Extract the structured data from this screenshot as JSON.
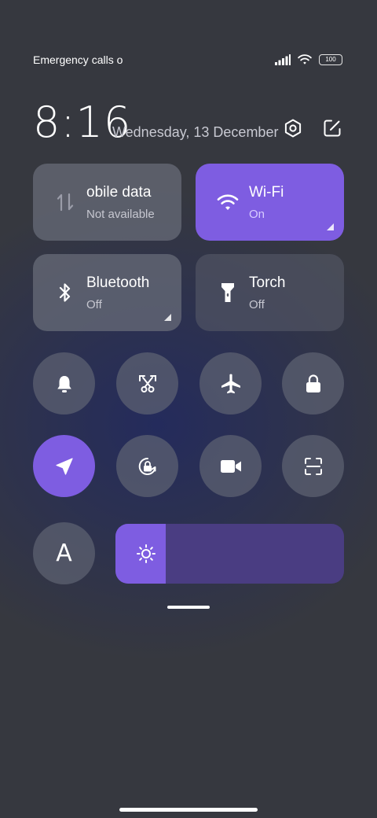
{
  "status_bar": {
    "carrier_text": "Emergency calls o",
    "battery": "100"
  },
  "header": {
    "time": "8:16",
    "date": "Wednesday, 13 December"
  },
  "tiles": {
    "mobile_data": {
      "label": "obile data",
      "status": "Not available"
    },
    "wifi": {
      "label": "Wi-Fi",
      "status": "On"
    },
    "bluetooth": {
      "label": "Bluetooth",
      "status": "Off"
    },
    "torch": {
      "label": "Torch",
      "status": "Off"
    }
  },
  "toggles": {
    "font_letter": "A"
  },
  "brightness": {
    "level_fraction": 0.22
  },
  "colors": {
    "accent": "#7e5de1",
    "tile_off": "#6a6d7a",
    "brightness_track": "#4a3d82"
  },
  "icons": [
    "signal-icon",
    "wifi-icon",
    "battery-icon",
    "settings-icon",
    "edit-icon",
    "mobile-data-icon",
    "bluetooth-icon",
    "torch-icon",
    "bell-icon",
    "screenshot-icon",
    "airplane-icon",
    "lock-icon",
    "location-icon",
    "auto-rotate-icon",
    "video-icon",
    "scan-icon",
    "sun-icon"
  ]
}
